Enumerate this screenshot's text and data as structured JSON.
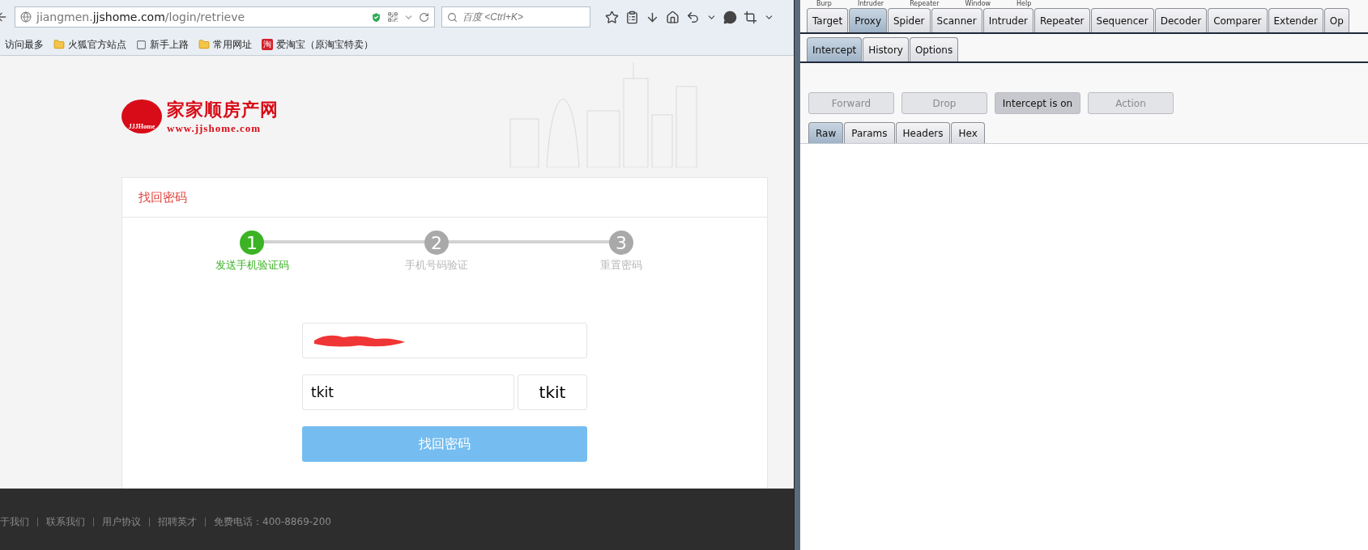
{
  "browser": {
    "url": {
      "host_prefix": "jiangmen.",
      "host_main": "jjshome.com",
      "path": "/login/retrieve"
    },
    "search": {
      "placeholder": "百度 <Ctrl+K>"
    },
    "bookmarks": [
      {
        "kind": "plain",
        "label": "访问最多"
      },
      {
        "kind": "folder",
        "label": "火狐官方站点"
      },
      {
        "kind": "page",
        "label": "新手上路"
      },
      {
        "kind": "folder",
        "label": "常用网址"
      },
      {
        "kind": "badge",
        "badge": "淘",
        "label": "爱淘宝（原淘宝特卖）"
      }
    ]
  },
  "site": {
    "logo": {
      "name": "家家顺房产网",
      "url": "www.jjshome.com",
      "badge": "JJJHome"
    },
    "card_title": "找回密码",
    "steps": [
      {
        "number": "1",
        "label": "发送手机验证码",
        "selected": true
      },
      {
        "number": "2",
        "label": "手机号码验证",
        "selected": false
      },
      {
        "number": "3",
        "label": "重置密码",
        "selected": false
      }
    ],
    "captcha_field": {
      "value": "tkit"
    },
    "captcha_image": "tkit",
    "submit": "找回密码",
    "footer": [
      "于我们",
      "联系我们",
      "用户协议",
      "招聘英才",
      "免费电话：400-8869-200"
    ]
  },
  "burp": {
    "menu": [
      "Burp",
      "Intruder",
      "Repeater",
      "Window",
      "Help"
    ],
    "tabs": [
      {
        "label": "Target",
        "selected": false
      },
      {
        "label": "Proxy",
        "selected": true
      },
      {
        "label": "Spider",
        "selected": false
      },
      {
        "label": "Scanner",
        "selected": false
      },
      {
        "label": "Intruder",
        "selected": false
      },
      {
        "label": "Repeater",
        "selected": false
      },
      {
        "label": "Sequencer",
        "selected": false
      },
      {
        "label": "Decoder",
        "selected": false
      },
      {
        "label": "Comparer",
        "selected": false
      },
      {
        "label": "Extender",
        "selected": false
      },
      {
        "label": "Op",
        "selected": false
      }
    ],
    "subtabs": [
      {
        "label": "Intercept",
        "selected": true
      },
      {
        "label": "History",
        "selected": false
      },
      {
        "label": "Options",
        "selected": false
      }
    ],
    "actions": [
      {
        "label": "Forward",
        "disabled": true
      },
      {
        "label": "Drop",
        "disabled": true
      },
      {
        "label": "Intercept is on",
        "disabled": false
      },
      {
        "label": "Action",
        "disabled": true
      }
    ],
    "message_tabs": [
      {
        "label": "Raw",
        "selected": true
      },
      {
        "label": "Params",
        "selected": false
      },
      {
        "label": "Headers",
        "selected": false
      },
      {
        "label": "Hex",
        "selected": false
      }
    ]
  }
}
